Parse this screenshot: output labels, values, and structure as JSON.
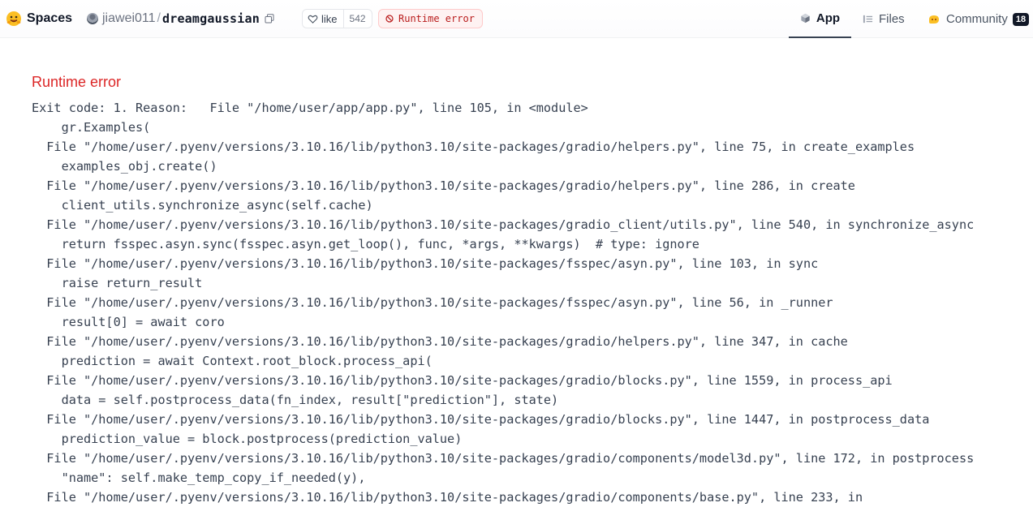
{
  "header": {
    "brand": "Spaces",
    "owner": "jiawei011",
    "separator": "/",
    "repo": "dreamgaussian",
    "like_label": "like",
    "like_count": "542",
    "status": "Runtime error",
    "tabs": [
      {
        "label": "App",
        "icon": "cube-icon",
        "active": true
      },
      {
        "label": "Files",
        "icon": "files-icon",
        "active": false
      },
      {
        "label": "Community",
        "icon": "community-icon",
        "active": false,
        "badge": "18"
      }
    ]
  },
  "colors": {
    "error": "#dc2626",
    "badge_bg": "#fef2f2",
    "badge_border": "#fecaca",
    "brand_yellow": "#fbbf24"
  },
  "error": {
    "title": "Runtime error",
    "lines": [
      "Exit code: 1. Reason:   File \"/home/user/app/app.py\", line 105, in <module>",
      "    gr.Examples(",
      "  File \"/home/user/.pyenv/versions/3.10.16/lib/python3.10/site-packages/gradio/helpers.py\", line 75, in create_examples",
      "    examples_obj.create()",
      "  File \"/home/user/.pyenv/versions/3.10.16/lib/python3.10/site-packages/gradio/helpers.py\", line 286, in create",
      "    client_utils.synchronize_async(self.cache)",
      "  File \"/home/user/.pyenv/versions/3.10.16/lib/python3.10/site-packages/gradio_client/utils.py\", line 540, in synchronize_async",
      "    return fsspec.asyn.sync(fsspec.asyn.get_loop(), func, *args, **kwargs)  # type: ignore",
      "  File \"/home/user/.pyenv/versions/3.10.16/lib/python3.10/site-packages/fsspec/asyn.py\", line 103, in sync",
      "    raise return_result",
      "  File \"/home/user/.pyenv/versions/3.10.16/lib/python3.10/site-packages/fsspec/asyn.py\", line 56, in _runner",
      "    result[0] = await coro",
      "  File \"/home/user/.pyenv/versions/3.10.16/lib/python3.10/site-packages/gradio/helpers.py\", line 347, in cache",
      "    prediction = await Context.root_block.process_api(",
      "  File \"/home/user/.pyenv/versions/3.10.16/lib/python3.10/site-packages/gradio/blocks.py\", line 1559, in process_api",
      "    data = self.postprocess_data(fn_index, result[\"prediction\"], state)",
      "  File \"/home/user/.pyenv/versions/3.10.16/lib/python3.10/site-packages/gradio/blocks.py\", line 1447, in postprocess_data",
      "    prediction_value = block.postprocess(prediction_value)",
      "  File \"/home/user/.pyenv/versions/3.10.16/lib/python3.10/site-packages/gradio/components/model3d.py\", line 172, in postprocess",
      "    \"name\": self.make_temp_copy_if_needed(y),",
      "  File \"/home/user/.pyenv/versions/3.10.16/lib/python3.10/site-packages/gradio/components/base.py\", line 233, in"
    ]
  }
}
